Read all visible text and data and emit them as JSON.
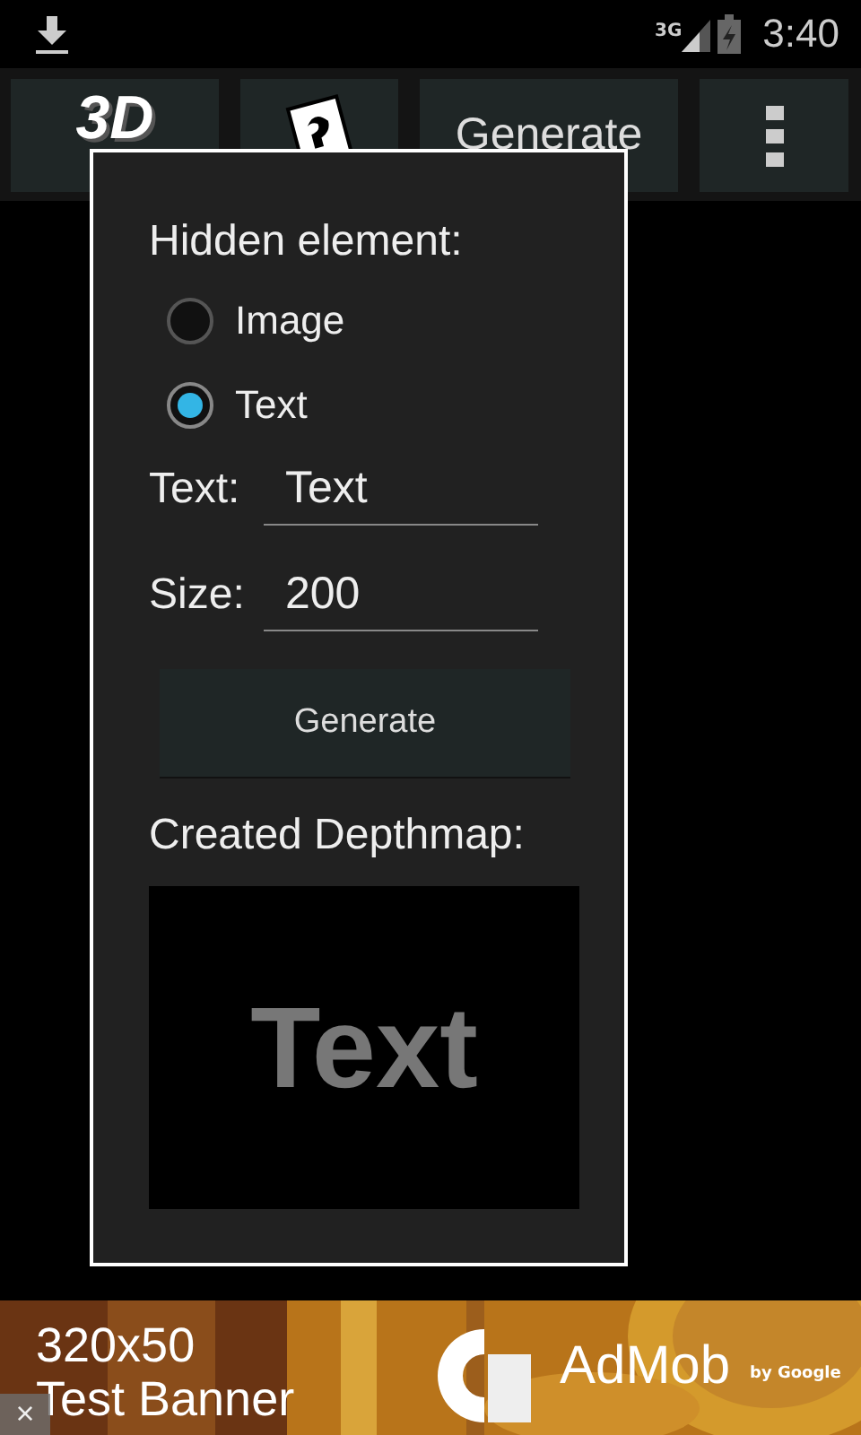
{
  "status_bar": {
    "time": "3:40",
    "network": "3G"
  },
  "action_bar": {
    "logo_text": "3D",
    "generate_label": "Generate"
  },
  "dialog": {
    "group_label": "Hidden element:",
    "options": [
      {
        "label": "Image",
        "selected": false
      },
      {
        "label": "Text",
        "selected": true
      }
    ],
    "fields": [
      {
        "label": "Text:",
        "value": "Text"
      },
      {
        "label": "Size:",
        "value": "200"
      }
    ],
    "button": "Generate",
    "preview_label": "Created Depthmap:",
    "preview_text": "Text"
  },
  "ad_banner": {
    "line_1": "320x50",
    "line_2": "Test Banner",
    "brand": "AdMob",
    "byline": "by Google",
    "close": "×"
  }
}
